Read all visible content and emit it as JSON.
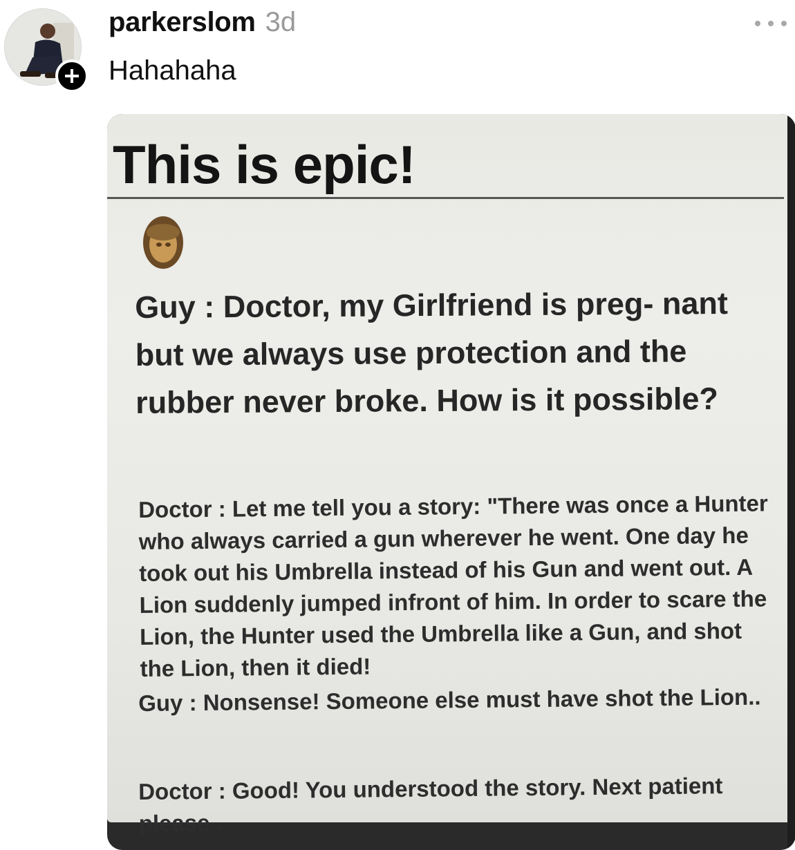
{
  "post": {
    "username": "parkerslom",
    "time": "3d",
    "caption": "Hahahaha",
    "icons": {
      "avatar": "profile-photo",
      "follow": "plus-icon",
      "more": "more-horizontal-icon"
    }
  },
  "image": {
    "title": "This is epic!",
    "question": "Guy : Doctor, my Girlfriend is preg- nant but we always use protection and the rubber never broke. How is it possible?",
    "answer1": "Doctor : Let me tell you a story: \"There was once a Hunter who always carried a gun wherever he went. One day he took out his Umbrella instead of his Gun and went out. A Lion suddenly jumped infront of him. In order to scare the Lion, the Hunter used the Umbrella like a Gun, and shot the Lion, then it died!",
    "answer2": "Guy : Nonsense! Someone else must have shot the Lion..",
    "answer3": "Doctor : Good! You understood the story. Next patient please.."
  }
}
